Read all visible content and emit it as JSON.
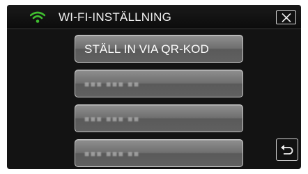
{
  "header": {
    "title": "WI-FI-INSTÄLLNING",
    "wifi_icon": "wifi-signal-icon",
    "wifi_color": "#3fbf2f",
    "close_icon": "close-x-icon"
  },
  "options": [
    {
      "label": "STÄLL IN VIA QR-KOD",
      "style": "primary"
    },
    {
      "label": "■■■ ■■■ ■■",
      "style": "greyed"
    },
    {
      "label": "■■■ ■■■ ■■",
      "style": "greyed"
    },
    {
      "label": "■■■ ■■■ ■■",
      "style": "greyed"
    }
  ],
  "footer": {
    "back_icon": "return-arrow-icon"
  }
}
